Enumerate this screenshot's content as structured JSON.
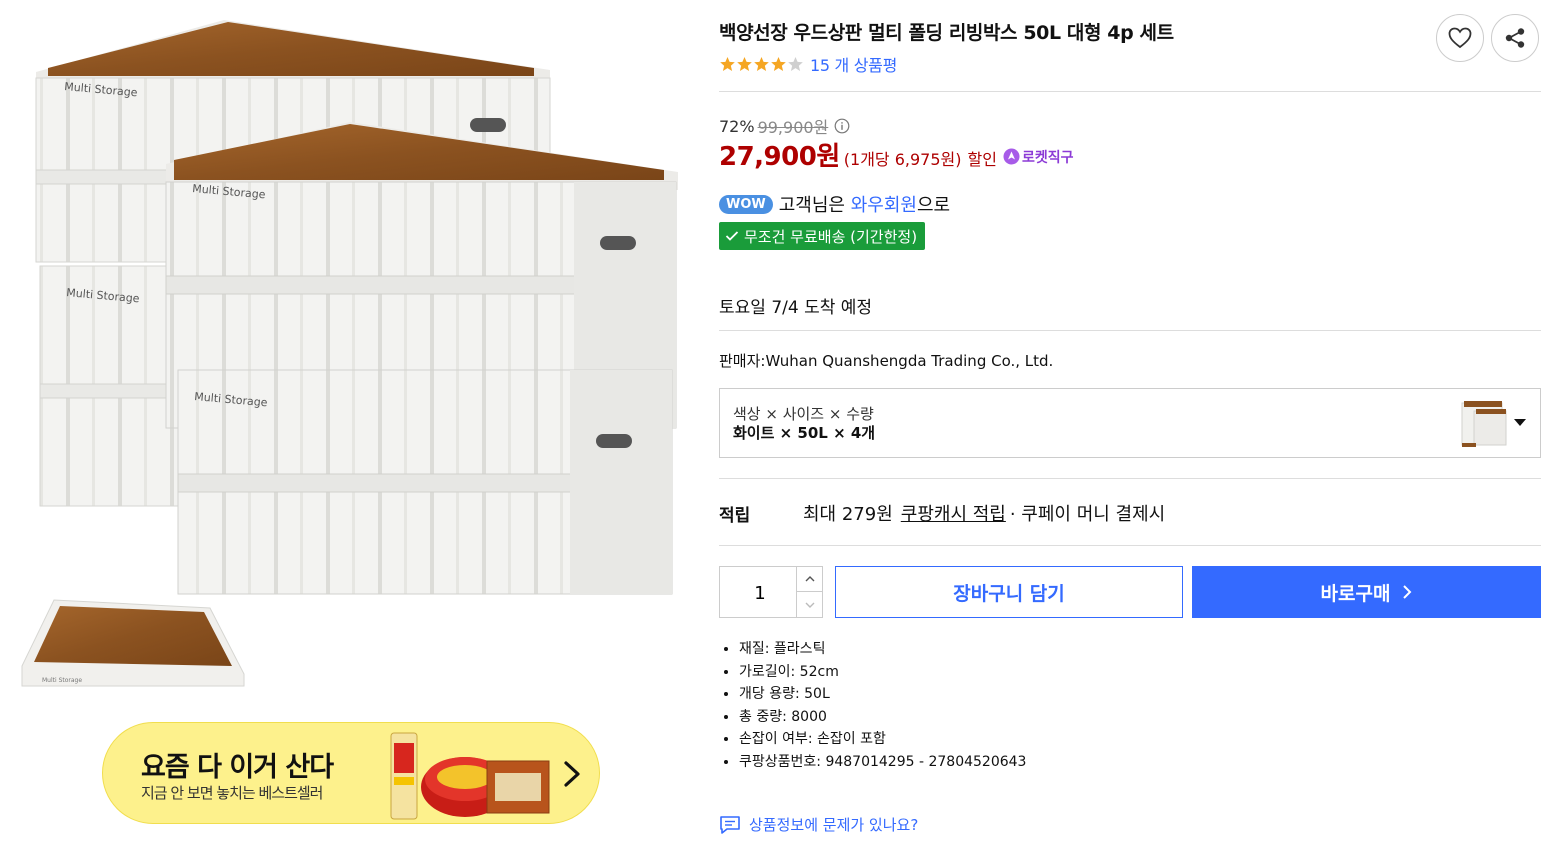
{
  "product": {
    "title": "백양선장 우드상판 멀티 폴딩 리빙박스 50L 대형 4p 세트",
    "rating": 4,
    "rating_max": 5,
    "review_count_text": "15 개 상품평",
    "discount_rate": "72%",
    "original_price": "99,900원",
    "sale_price": "27,900원",
    "unit_price": "(1개당 6,975원)",
    "sale_label": "할인",
    "rocket_badge": "로켓직구",
    "image_label": "Multi Storage"
  },
  "wow": {
    "badge": "WOW",
    "prefix": "고객님은 ",
    "highlight": "와우회원",
    "suffix": "으로"
  },
  "free_shipping": "무조건 무료배송 (기간한정)",
  "delivery": "토요일 7/4 도착 예정",
  "seller": "판매자:Wuhan Quanshengda Trading Co., Ltd.",
  "options": {
    "header": "색상 × 사이즈 × 수량",
    "value": "화이트 × 50L × 4개"
  },
  "points": {
    "label": "적립",
    "prefix": "최대 279원",
    "link": "쿠팡캐시 적립",
    "suffix": "· 쿠페이 머니 결제시"
  },
  "quantity": "1",
  "buttons": {
    "cart": "장바구니 담기",
    "buy": "바로구매"
  },
  "specs": [
    "재질: 플라스틱",
    "가로길이: 52cm",
    "개당 용량: 50L",
    "총 중량: 8000",
    "손잡이 여부: 손잡이 포함",
    "쿠팡상품번호: 9487014295 - 27804520643"
  ],
  "report_link": "상품정보에 문제가 있나요?",
  "banner": {
    "title": "요즘 다 이거 산다",
    "subtitle": "지금 안 보면 놓치는 베스트셀러"
  },
  "colors": {
    "accent": "#346aff",
    "price": "#ae0000",
    "free_ship": "#1a9c3a",
    "star": "#f5a623",
    "banner": "#fdf18c"
  }
}
